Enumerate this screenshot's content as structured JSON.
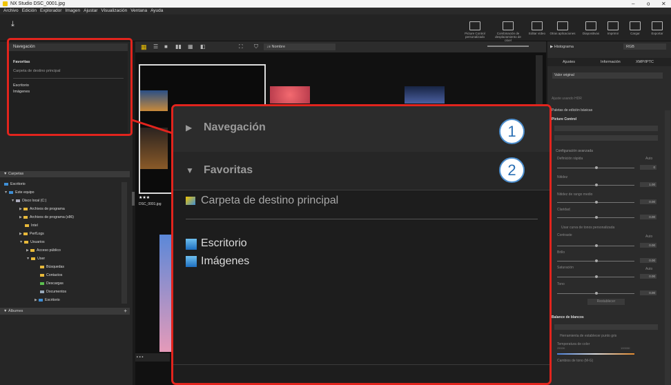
{
  "window": {
    "title": "NX Studio   DSC_0001.jpg",
    "minimize": "–",
    "maximize": "o",
    "close": "✕"
  },
  "menu": [
    "Archivo",
    "Edición",
    "Explorador",
    "Imagen",
    "Ajustar",
    "Visualización",
    "Ventana",
    "Ayuda"
  ],
  "toolbar": {
    "items": [
      "Picture Control personalizado",
      "Combinación de desplazamiento de píxel",
      "Editar vídeo",
      "Otras aplicaciones",
      "Diapositivas",
      "Imprimir",
      "Cargar",
      "Exportar"
    ]
  },
  "navigation_panel": {
    "title": "Navegación",
    "favorites_label": "Favoritas",
    "favorites_item": "Carpeta de destino principal",
    "items": [
      "Escritorio",
      "Imágenes"
    ]
  },
  "folders": {
    "title": "Carpetas",
    "tree": [
      "Escritorio",
      "Este equipo",
      "Disco local (C:)",
      "Archivos de programa",
      "Archivos de programa (x86)",
      "Intel",
      "PerfLogs",
      "Usuarios",
      "Acceso público",
      "User",
      "Búsquedas",
      "Contactos",
      "Descargas",
      "Documentos",
      "Escritorio"
    ]
  },
  "albums": {
    "title": "Álbumes",
    "add": "+"
  },
  "thumbs": {
    "sort_label": "Nombre",
    "rating": "★★★",
    "filename": "DSC_0001.jpg"
  },
  "right_panel": {
    "histogram_label": "Histograma",
    "histogram_mode": "RGB",
    "tabs": [
      "Ajustes",
      "Información",
      "XMP/IPTC"
    ],
    "preset": "Valor original",
    "hdr": "Ajuste usando HDR",
    "palette_label": "Paletas de edición básicas",
    "picture_control": "Picture Control",
    "advanced": "Configuración avanzada",
    "sliders": [
      {
        "label": "Definición rápida",
        "value": "0",
        "auto": "Auto"
      },
      {
        "label": "Nitidez",
        "value": "1.00"
      },
      {
        "label": "Nitidez de rango medio",
        "value": "0.00"
      },
      {
        "label": "Claridad",
        "value": "0.00"
      }
    ],
    "curve": "Usar curva de tonos personalizada",
    "sliders2": [
      {
        "label": "Contraste",
        "value": "0.00",
        "auto": "Auto"
      },
      {
        "label": "Brillo",
        "value": "0.00"
      },
      {
        "label": "Saturación",
        "value": "0.00",
        "auto": "Auto"
      },
      {
        "label": "Tono",
        "value": "0.00"
      }
    ],
    "reset": "Restablecer",
    "wb": "Balance de blancos",
    "wb_tool": "Herramienta de establecer punto gris",
    "temp": "Temperatura de color",
    "temp_min": "2500K",
    "temp_max": "10000K",
    "tint": "Cambios de tono (M-G)"
  },
  "zoom_callout": {
    "navigation": "Navegación",
    "favorites": "Favoritas",
    "favorite_item": "Carpeta de destino principal",
    "items": [
      "Escritorio",
      "Imágenes"
    ],
    "badge1": "1",
    "badge2": "2"
  }
}
